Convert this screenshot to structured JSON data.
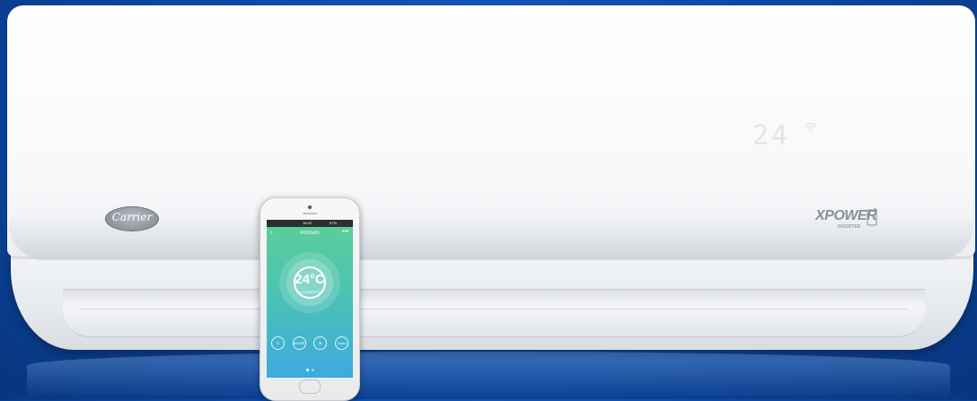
{
  "unit": {
    "display_temperature": "24",
    "brand": "Carrier",
    "product_line": "XPOWER",
    "product_line_sub": "INVERTER"
  },
  "phone_app": {
    "status_time": "16:32",
    "status_battery": "67%",
    "title": "RODGAS",
    "temperature": "24°C",
    "mode": "AUTOMATICO",
    "controls": [
      {
        "icon": "power-icon",
        "label": "⏻"
      },
      {
        "icon": "mode-icon",
        "label": "MODE"
      },
      {
        "icon": "fan-icon",
        "label": "✻"
      },
      {
        "icon": "turbo-icon",
        "label": "Turbo"
      }
    ]
  },
  "colors": {
    "background": "#0d4aa6",
    "screen_top": "#5ccf96",
    "screen_bottom": "#3ea9e0"
  }
}
